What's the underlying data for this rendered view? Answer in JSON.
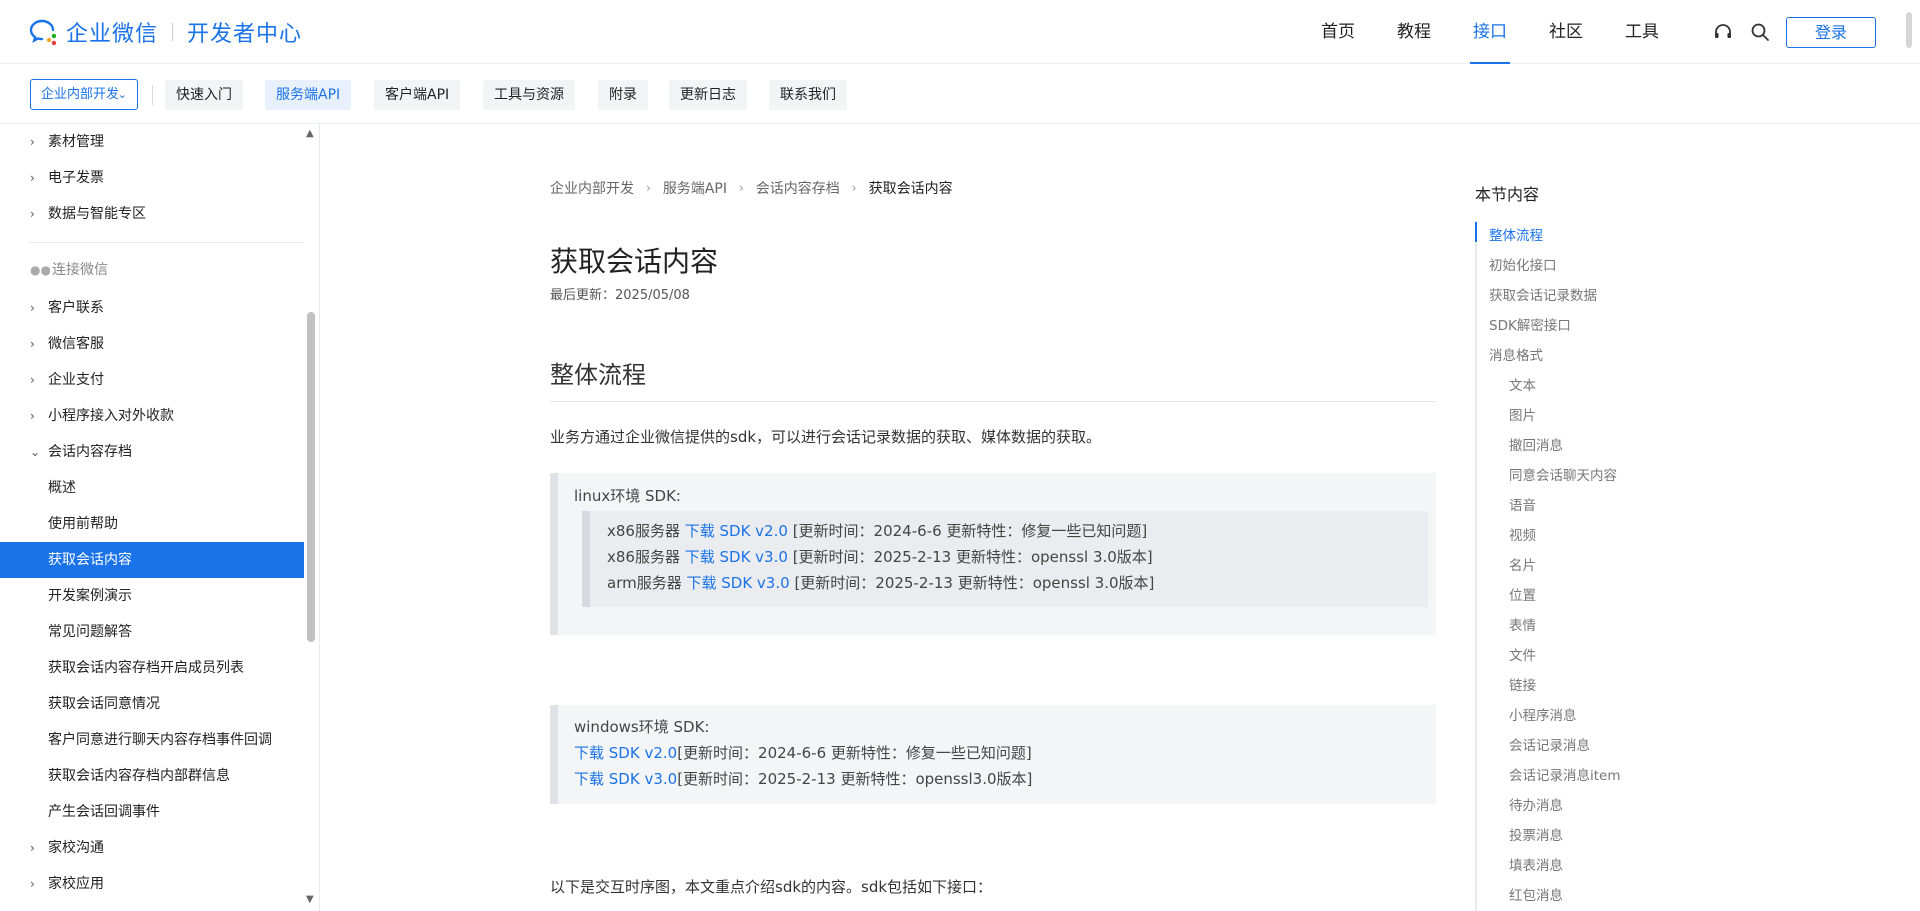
{
  "header": {
    "brand": "企业微信",
    "subtitle": "开发者中心",
    "nav": [
      "首页",
      "教程",
      "接口",
      "社区",
      "工具"
    ],
    "active_nav": "接口",
    "login": "登录",
    "icons": [
      "headset-icon",
      "search-icon"
    ]
  },
  "subnav": {
    "select_label": "企业内部开发",
    "tabs": [
      "快速入门",
      "服务端API",
      "客户端API",
      "工具与资源",
      "附录",
      "更新日志",
      "联系我们"
    ],
    "active_tab": "服务端API"
  },
  "sidebar": {
    "items_top": [
      "素材管理",
      "电子发票",
      "数据与智能专区"
    ],
    "section_label": "连接微信",
    "items_mid": [
      "客户联系",
      "微信客服",
      "企业支付",
      "小程序接入对外收款"
    ],
    "expanded_parent": "会话内容存档",
    "children": [
      "概述",
      "使用前帮助",
      "获取会话内容",
      "开发案例演示",
      "常见问题解答",
      "获取会话内容存档开启成员列表",
      "获取会话同意情况",
      "客户同意进行聊天内容存档事件回调",
      "获取会话内容存档内部群信息",
      "产生会话回调事件"
    ],
    "active_child": "获取会话内容",
    "items_bottom": [
      "家校沟通",
      "家校应用"
    ]
  },
  "main": {
    "breadcrumb": [
      "企业内部开发",
      "服务端API",
      "会话内容存档",
      "获取会话内容"
    ],
    "title": "获取会话内容",
    "updated": "最后更新：2025/05/08",
    "section_title": "整体流程",
    "intro": "业务方通过企业微信提供的sdk，可以进行会话记录数据的获取、媒体数据的获取。",
    "linux": {
      "heading": "linux环境 SDK:",
      "rows": [
        {
          "prefix": "x86服务器 ",
          "link": "下载 SDK v2.0",
          "suffix": " [更新时间：2024-6-6 更新特性：修复一些已知问题]"
        },
        {
          "prefix": "x86服务器 ",
          "link": "下载 SDK v3.0",
          "suffix": " [更新时间：2025-2-13 更新特性：openssl 3.0版本]"
        },
        {
          "prefix": "arm服务器 ",
          "link": "下载 SDK v3.0",
          "suffix": " [更新时间：2025-2-13 更新特性：openssl 3.0版本]"
        }
      ]
    },
    "windows": {
      "heading": "windows环境 SDK:",
      "rows": [
        {
          "link": "下载 SDK v2.0",
          "suffix": "[更新时间：2024-6-6 更新特性：修复一些已知问题]"
        },
        {
          "link": "下载 SDK v3.0",
          "suffix": "[更新时间：2025-2-13 更新特性：openssl3.0版本]"
        }
      ]
    },
    "outro": "以下是交互时序图，本文重点介绍sdk的内容。sdk包括如下接口："
  },
  "toc": {
    "title": "本节内容",
    "level1": [
      "整体流程",
      "初始化接口",
      "获取会话记录数据",
      "SDK解密接口",
      "消息格式"
    ],
    "level2": [
      "文本",
      "图片",
      "撤回消息",
      "同意会话聊天内容",
      "语音",
      "视频",
      "名片",
      "位置",
      "表情",
      "文件",
      "链接",
      "小程序消息",
      "会话记录消息",
      "会话记录消息item",
      "待办消息",
      "投票消息",
      "填表消息",
      "红包消息"
    ],
    "active": "整体流程"
  },
  "colors": {
    "accent": "#1a73e8"
  }
}
